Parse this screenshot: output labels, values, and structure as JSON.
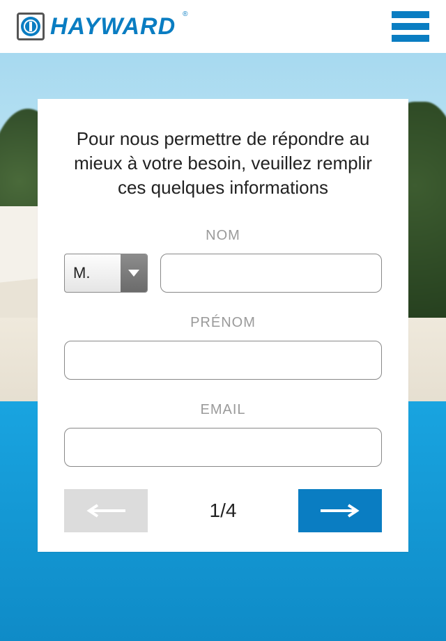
{
  "brand": {
    "name": "HAYWARD",
    "registered": "®"
  },
  "form": {
    "intro": "Pour nous permettre de répondre au mieux à votre besoin, veuillez remplir ces quelques informations",
    "title_select": {
      "value": "M."
    },
    "fields": {
      "nom": {
        "label": "NOM",
        "value": ""
      },
      "prenom": {
        "label": "PRÉNOM",
        "value": ""
      },
      "email": {
        "label": "EMAIL",
        "value": ""
      }
    },
    "pager": "1/4"
  },
  "colors": {
    "brand_blue": "#0a7dc2"
  }
}
